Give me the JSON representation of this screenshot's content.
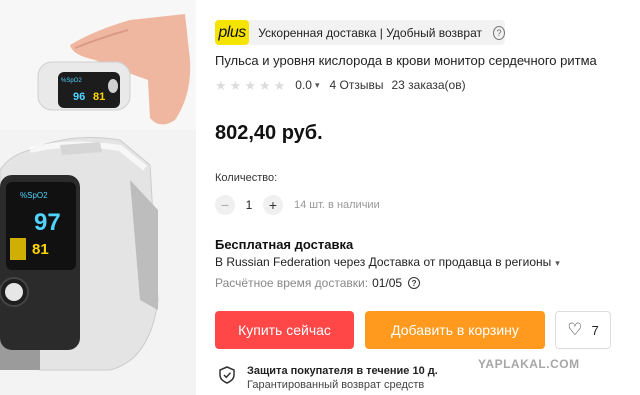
{
  "promo": {
    "logo": "plus",
    "text": "Ускоренная доставка | Удобный возврат",
    "help_icon": "question-icon"
  },
  "product": {
    "title": "Пульса и уровня кислорода в крови монитор сердечного ритма",
    "rating": "0.0",
    "rating_stars": 0,
    "reviews": "4 Отзывы",
    "orders": "23 заказа(ов)",
    "price": "802,40 руб."
  },
  "quantity": {
    "label": "Количество:",
    "value": "1",
    "stock": "14 шт. в наличии"
  },
  "shipping": {
    "title": "Бесплатная доставка",
    "route": "В Russian Federation через Доставка от продавца в регионы",
    "time_label": "Расчётное время доставки:",
    "time_value": "01/05"
  },
  "actions": {
    "buy": "Купить сейчас",
    "cart": "Добавить в корзину",
    "wishlist_count": "7"
  },
  "protection": {
    "title": "Защита покупателя в течение 10 д.",
    "subtitle": "Гарантированный возврат средств"
  },
  "watermark": "YAPLAKAL.COM",
  "device_display": {
    "small_left": "96",
    "small_right": "81",
    "large_spo2": "97",
    "large_pr": "81",
    "spo2_label": "%SpO2"
  },
  "colors": {
    "buy": "#ff4747",
    "cart": "#ff9a1f",
    "plus_logo": "#f5e300"
  }
}
